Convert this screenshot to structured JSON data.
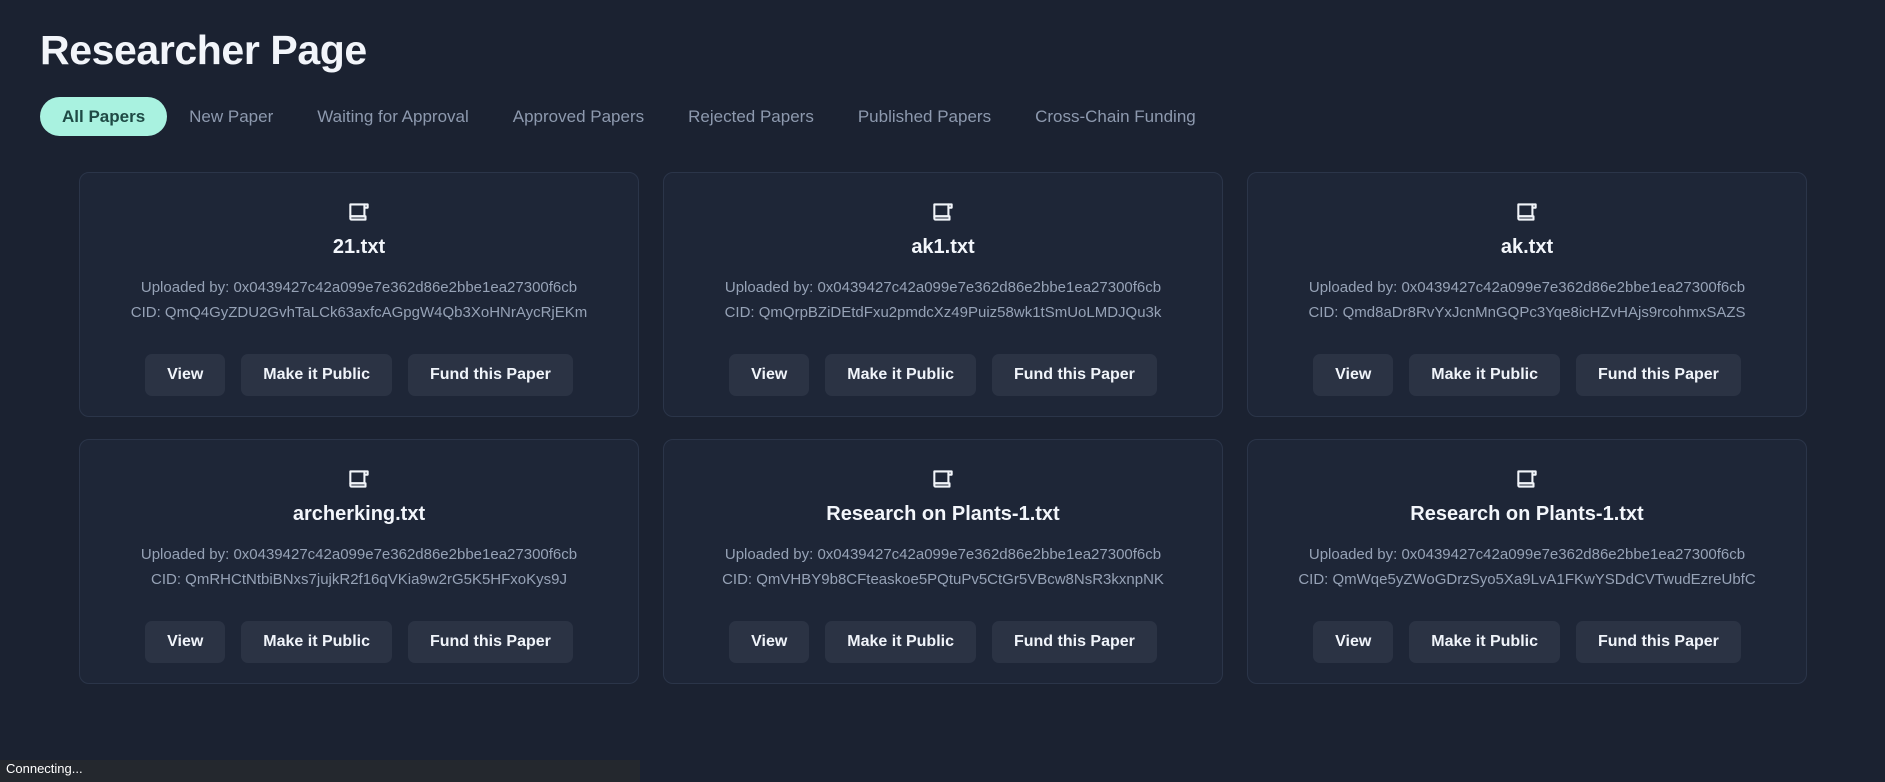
{
  "header": {
    "title": "Researcher Page"
  },
  "tabs": [
    {
      "label": "All Papers",
      "active": true
    },
    {
      "label": "New Paper",
      "active": false
    },
    {
      "label": "Waiting for Approval",
      "active": false
    },
    {
      "label": "Approved Papers",
      "active": false
    },
    {
      "label": "Rejected Papers",
      "active": false
    },
    {
      "label": "Published Papers",
      "active": false
    },
    {
      "label": "Cross-Chain Funding",
      "active": false
    }
  ],
  "labels": {
    "uploaded_by_prefix": "Uploaded by: ",
    "cid_prefix": "CID: ",
    "view": "View",
    "make_public": "Make it Public",
    "fund": "Fund this Paper",
    "icon": "document-scroll-icon"
  },
  "cards": [
    {
      "title": "21.txt",
      "uploaded_by": "Uploaded by: 0x0439427c42a099e7e362d86e2bbe1ea27300f6cb",
      "cid": "CID: QmQ4GyZDU2GvhTaLCk63axfcAGpgW4Qb3XoHNrAycRjEKm",
      "view": "View",
      "make_public": "Make it Public",
      "fund": "Fund this Paper"
    },
    {
      "title": "ak1.txt",
      "uploaded_by": "Uploaded by: 0x0439427c42a099e7e362d86e2bbe1ea27300f6cb",
      "cid": "CID: QmQrpBZiDEtdFxu2pmdcXz49Puiz58wk1tSmUoLMDJQu3k",
      "view": "View",
      "make_public": "Make it Public",
      "fund": "Fund this Paper"
    },
    {
      "title": "ak.txt",
      "uploaded_by": "Uploaded by: 0x0439427c42a099e7e362d86e2bbe1ea27300f6cb",
      "cid": "CID: Qmd8aDr8RvYxJcnMnGQPc3Yqe8icHZvHAjs9rcohmxSAZS",
      "view": "View",
      "make_public": "Make it Public",
      "fund": "Fund this Paper"
    },
    {
      "title": "archerking.txt",
      "uploaded_by": "Uploaded by: 0x0439427c42a099e7e362d86e2bbe1ea27300f6cb",
      "cid": "CID: QmRHCtNtbiBNxs7jujkR2f16qVKia9w2rG5K5HFxoKys9J",
      "view": "View",
      "make_public": "Make it Public",
      "fund": "Fund this Paper"
    },
    {
      "title": "Research on Plants-1.txt",
      "uploaded_by": "Uploaded by: 0x0439427c42a099e7e362d86e2bbe1ea27300f6cb",
      "cid": "CID: QmVHBY9b8CFteaskoe5PQtuPv5CtGr5VBcw8NsR3kxnpNK",
      "view": "View",
      "make_public": "Make it Public",
      "fund": "Fund this Paper"
    },
    {
      "title": "Research on Plants-1.txt",
      "uploaded_by": "Uploaded by: 0x0439427c42a099e7e362d86e2bbe1ea27300f6cb",
      "cid": "CID: QmWqe5yZWoGDrzSyo5Xa9LvA1FKwYSDdCVTwudEzreUbfC",
      "view": "View",
      "make_public": "Make it Public",
      "fund": "Fund this Paper"
    }
  ],
  "status_bar": {
    "text": "Connecting..."
  },
  "colors": {
    "background": "#1b2231",
    "card_background": "#1e2637",
    "card_border": "#2b3549",
    "accent": "#a9f2e0",
    "accent_text": "#1f4a45",
    "muted_text": "#96a2b6",
    "tab_inactive": "#8d99ae",
    "button_background": "#2b3344"
  }
}
